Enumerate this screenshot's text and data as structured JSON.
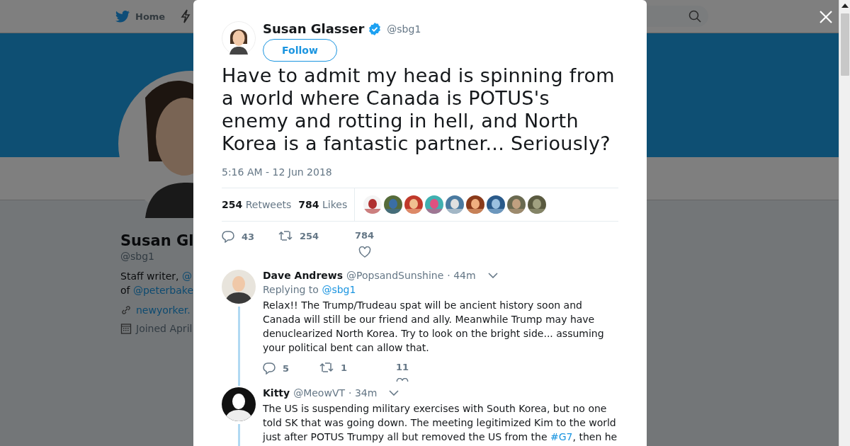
{
  "background": {
    "nav": {
      "items": [
        {
          "label": "Home",
          "kind": "home"
        },
        {
          "kind": "bolt"
        }
      ]
    },
    "profile": {
      "name": "Susan Gl",
      "handle": "@sbg1",
      "bio": [
        {
          "text": "Staff writer, ",
          "link": "@"
        },
        {
          "text": "of ",
          "link": "@peterbake"
        }
      ],
      "link": "newyorker.",
      "joined": "Joined April"
    }
  },
  "tweet": {
    "author": {
      "name": "Susan Glasser",
      "verified": true,
      "handle": "@sbg1"
    },
    "follow": "Follow",
    "text": "Have to admit my head is spinning from a world where Canada is POTUS's enemy and rotting in hell, and North Korea is a fantastic partner... Seriously?",
    "time": "5:16 AM - 12 Jun 2018",
    "stats": [
      {
        "count": "254",
        "label": "Retweets"
      },
      {
        "count": "784",
        "label": "Likes"
      }
    ],
    "actions": [
      {
        "kind": "reply",
        "count": "43"
      },
      {
        "kind": "retweet",
        "count": "254"
      },
      {
        "kind": "like",
        "count": "784"
      }
    ]
  },
  "replies": [
    {
      "name": "Dave Andrews",
      "handle": "@PopsandSunshine",
      "time": "· 44m",
      "replying_to": {
        "label": "Replying to ",
        "handle": "@sbg1"
      },
      "text": "Relax!! The Trump/Trudeau spat will be ancient history soon and Canada will still be our friend and ally. Meanwhile Trump may have denuclearized North Korea. Try to look on the bright side... assuming your political bent can allow that.",
      "actions": [
        {
          "kind": "reply",
          "count": "5"
        },
        {
          "kind": "retweet",
          "count": "1"
        },
        {
          "kind": "like",
          "count": "11"
        }
      ]
    },
    {
      "name": "Kitty",
      "handle": "@MeowVT",
      "time": "· 34m",
      "text": "The US is suspending military exercises with South Korea, but no one told SK that was going down. The meeting legitimized Kim to the world just after POTUS Trumpy all but removed the US from the **#G7**, then he"
    }
  ]
}
